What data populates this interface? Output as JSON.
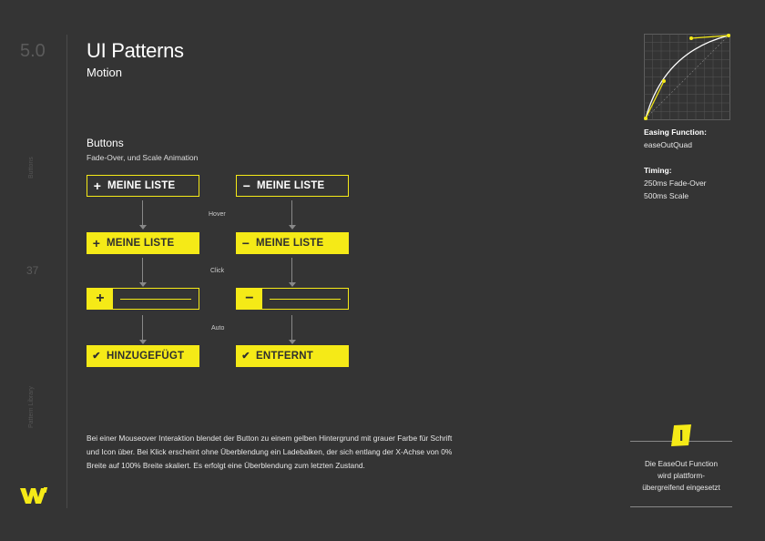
{
  "sidebar": {
    "section_number": "5.0",
    "page_number": "37",
    "vertical_top": "Buttons",
    "vertical_bottom": "Pattern Library"
  },
  "header": {
    "title": "UI Patterns",
    "subtitle": "Motion"
  },
  "section": {
    "title": "Buttons",
    "subtitle": "Fade-Over, und Scale Animation"
  },
  "flows": {
    "add": {
      "default_label": "MEINE LISTE",
      "hover_label": "MEINE LISTE",
      "done_label": "HINZUGEFÜGT",
      "symbol": "+"
    },
    "remove": {
      "default_label": "MEINE LISTE",
      "hover_label": "MEINE LISTE",
      "done_label": "ENTFERNT",
      "symbol": "−"
    },
    "check_symbol": "✔",
    "steps": [
      "Hover",
      "Click",
      "Auto"
    ]
  },
  "description": "Bei einer Mouseover Interaktion blendet der Button zu einem gelben Hintergrund mit grauer Farbe für Schrift und Icon über. Bei Klick erscheint ohne Überblendung ein Ladebalken, der sich entlang der X-Achse von 0% Breite auf 100% Breite skaliert. Es erfolgt eine Überblendung zum letzten Zustand.",
  "info": {
    "easing_label": "Easing Function:",
    "easing_value": "easeOutQuad",
    "timing_label": "Timing:",
    "timing_line1": "250ms Fade-Over",
    "timing_line2": "500ms Scale"
  },
  "note": {
    "icon_char": "I",
    "line1": "Die EaseOut Function",
    "line2": "wird plattform-",
    "line3": "übergreifend eingesetzt"
  },
  "colors": {
    "accent": "#f5ea17",
    "background": "#343434",
    "muted": "#5b5b5b"
  }
}
